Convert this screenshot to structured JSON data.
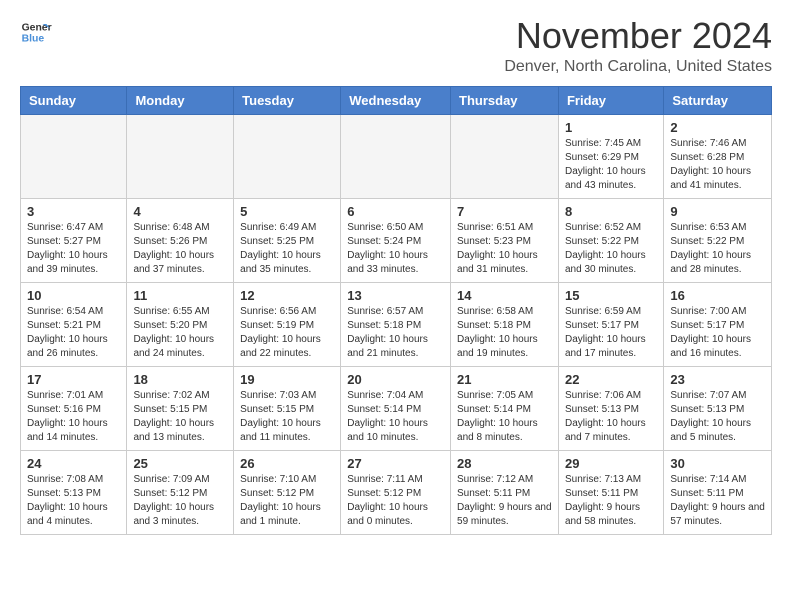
{
  "header": {
    "logo_line1": "General",
    "logo_line2": "Blue",
    "month_title": "November 2024",
    "location": "Denver, North Carolina, United States"
  },
  "weekdays": [
    "Sunday",
    "Monday",
    "Tuesday",
    "Wednesday",
    "Thursday",
    "Friday",
    "Saturday"
  ],
  "weeks": [
    [
      {
        "day": "",
        "empty": true
      },
      {
        "day": "",
        "empty": true
      },
      {
        "day": "",
        "empty": true
      },
      {
        "day": "",
        "empty": true
      },
      {
        "day": "",
        "empty": true
      },
      {
        "day": "1",
        "sunrise": "7:45 AM",
        "sunset": "6:29 PM",
        "daylight": "10 hours and 43 minutes."
      },
      {
        "day": "2",
        "sunrise": "7:46 AM",
        "sunset": "6:28 PM",
        "daylight": "10 hours and 41 minutes."
      }
    ],
    [
      {
        "day": "3",
        "sunrise": "6:47 AM",
        "sunset": "5:27 PM",
        "daylight": "10 hours and 39 minutes."
      },
      {
        "day": "4",
        "sunrise": "6:48 AM",
        "sunset": "5:26 PM",
        "daylight": "10 hours and 37 minutes."
      },
      {
        "day": "5",
        "sunrise": "6:49 AM",
        "sunset": "5:25 PM",
        "daylight": "10 hours and 35 minutes."
      },
      {
        "day": "6",
        "sunrise": "6:50 AM",
        "sunset": "5:24 PM",
        "daylight": "10 hours and 33 minutes."
      },
      {
        "day": "7",
        "sunrise": "6:51 AM",
        "sunset": "5:23 PM",
        "daylight": "10 hours and 31 minutes."
      },
      {
        "day": "8",
        "sunrise": "6:52 AM",
        "sunset": "5:22 PM",
        "daylight": "10 hours and 30 minutes."
      },
      {
        "day": "9",
        "sunrise": "6:53 AM",
        "sunset": "5:22 PM",
        "daylight": "10 hours and 28 minutes."
      }
    ],
    [
      {
        "day": "10",
        "sunrise": "6:54 AM",
        "sunset": "5:21 PM",
        "daylight": "10 hours and 26 minutes."
      },
      {
        "day": "11",
        "sunrise": "6:55 AM",
        "sunset": "5:20 PM",
        "daylight": "10 hours and 24 minutes."
      },
      {
        "day": "12",
        "sunrise": "6:56 AM",
        "sunset": "5:19 PM",
        "daylight": "10 hours and 22 minutes."
      },
      {
        "day": "13",
        "sunrise": "6:57 AM",
        "sunset": "5:18 PM",
        "daylight": "10 hours and 21 minutes."
      },
      {
        "day": "14",
        "sunrise": "6:58 AM",
        "sunset": "5:18 PM",
        "daylight": "10 hours and 19 minutes."
      },
      {
        "day": "15",
        "sunrise": "6:59 AM",
        "sunset": "5:17 PM",
        "daylight": "10 hours and 17 minutes."
      },
      {
        "day": "16",
        "sunrise": "7:00 AM",
        "sunset": "5:17 PM",
        "daylight": "10 hours and 16 minutes."
      }
    ],
    [
      {
        "day": "17",
        "sunrise": "7:01 AM",
        "sunset": "5:16 PM",
        "daylight": "10 hours and 14 minutes."
      },
      {
        "day": "18",
        "sunrise": "7:02 AM",
        "sunset": "5:15 PM",
        "daylight": "10 hours and 13 minutes."
      },
      {
        "day": "19",
        "sunrise": "7:03 AM",
        "sunset": "5:15 PM",
        "daylight": "10 hours and 11 minutes."
      },
      {
        "day": "20",
        "sunrise": "7:04 AM",
        "sunset": "5:14 PM",
        "daylight": "10 hours and 10 minutes."
      },
      {
        "day": "21",
        "sunrise": "7:05 AM",
        "sunset": "5:14 PM",
        "daylight": "10 hours and 8 minutes."
      },
      {
        "day": "22",
        "sunrise": "7:06 AM",
        "sunset": "5:13 PM",
        "daylight": "10 hours and 7 minutes."
      },
      {
        "day": "23",
        "sunrise": "7:07 AM",
        "sunset": "5:13 PM",
        "daylight": "10 hours and 5 minutes."
      }
    ],
    [
      {
        "day": "24",
        "sunrise": "7:08 AM",
        "sunset": "5:13 PM",
        "daylight": "10 hours and 4 minutes."
      },
      {
        "day": "25",
        "sunrise": "7:09 AM",
        "sunset": "5:12 PM",
        "daylight": "10 hours and 3 minutes."
      },
      {
        "day": "26",
        "sunrise": "7:10 AM",
        "sunset": "5:12 PM",
        "daylight": "10 hours and 1 minute."
      },
      {
        "day": "27",
        "sunrise": "7:11 AM",
        "sunset": "5:12 PM",
        "daylight": "10 hours and 0 minutes."
      },
      {
        "day": "28",
        "sunrise": "7:12 AM",
        "sunset": "5:11 PM",
        "daylight": "9 hours and 59 minutes."
      },
      {
        "day": "29",
        "sunrise": "7:13 AM",
        "sunset": "5:11 PM",
        "daylight": "9 hours and 58 minutes."
      },
      {
        "day": "30",
        "sunrise": "7:14 AM",
        "sunset": "5:11 PM",
        "daylight": "9 hours and 57 minutes."
      }
    ]
  ]
}
